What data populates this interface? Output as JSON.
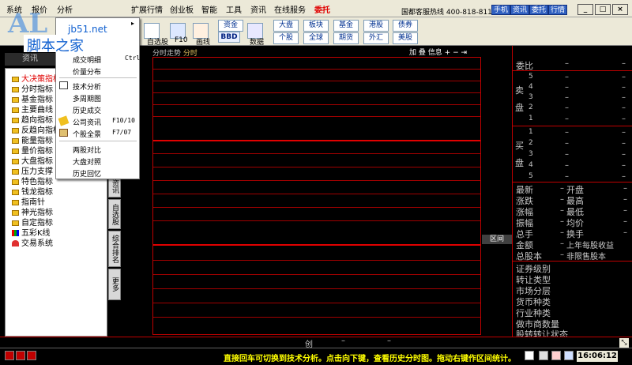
{
  "menubar": {
    "items": [
      "系统",
      "报价",
      "分析",
      "",
      "扩展行情",
      "创业板",
      "智能",
      "工具",
      "资讯",
      "在线服务",
      "委托"
    ],
    "hotline": "国都客服热线 400-818-8118",
    "mode_buttons": [
      "手机",
      "资讯",
      "委托",
      "行情"
    ],
    "win_buttons": [
      "_",
      "□",
      "×"
    ]
  },
  "watermark": {
    "logo_text": "AL",
    "url": "jb51.net",
    "site_name": "脚本之家"
  },
  "toolbar": {
    "labels": [
      "自选股",
      "F10",
      "画线",
      "数据"
    ],
    "bbd": "BBD",
    "row1_buttons": [
      "资金",
      "大盘",
      "板块",
      "基金",
      "港股",
      "债券"
    ],
    "row2_buttons": [
      "个股",
      "全球",
      "期货",
      "外汇",
      "美股"
    ]
  },
  "left_panel": {
    "tab_label": "资讯",
    "tree": [
      "大决策指标",
      "分时指标",
      "基金指标",
      "主要曲线",
      "趋向指标",
      "反趋向指标",
      "能量指标",
      "量价指标",
      "大盘指标",
      "压力支撑",
      "特色指标",
      "钱龙指标",
      "指南针",
      "神光指标",
      "自定指标",
      "五彩K线",
      "交易系统"
    ]
  },
  "dropdown": {
    "items": [
      {
        "label": "成交明细",
        "key": "Ctrl+T"
      },
      {
        "label": "价量分布",
        "key": ""
      },
      {
        "label": "技术分析",
        "key": ""
      },
      {
        "label": "多周期图",
        "key": ""
      },
      {
        "label": "历史成交",
        "key": ""
      },
      {
        "label": "公司资讯",
        "key": "F10/10"
      },
      {
        "label": "个股全景",
        "key": "F7/07"
      },
      {
        "label": "两股对比",
        "key": ""
      },
      {
        "label": "大盘对照",
        "key": ""
      },
      {
        "label": "历史回忆",
        "key": ""
      }
    ]
  },
  "side_tabs": [
    "资讯",
    "自选股",
    "综合排名",
    "更多"
  ],
  "chart": {
    "header_prefix": "分时走势",
    "header_selected": "分时",
    "tools": [
      "加",
      "叠",
      "信息",
      "+",
      "−",
      "⇥"
    ],
    "range_button": "区间"
  },
  "right_panel": {
    "webi": "委比",
    "sell_label": "卖盘",
    "buy_label": "买盘",
    "levels": [
      "5",
      "4",
      "3",
      "2",
      "1"
    ],
    "dash": "–",
    "stats_left": [
      "最新",
      "涨跌",
      "涨幅",
      "振幅",
      "总手",
      "金额",
      "总股本"
    ],
    "stats_right": [
      "开盘",
      "最高",
      "最低",
      "均价",
      "换手",
      "上年每股收益",
      "非限售股本"
    ],
    "info_rows": [
      "证券级别",
      "转让类型",
      "市场分层",
      "货币种类",
      "行业种类",
      "做市商数量",
      "股转转让状态"
    ]
  },
  "statusbar": {
    "center": "创"
  },
  "bottom": {
    "hint": "直接回车可切换到技术分析。点击向下键，查看历史分时图。拖动右键作区间统计。",
    "clock": "16:06:12"
  }
}
